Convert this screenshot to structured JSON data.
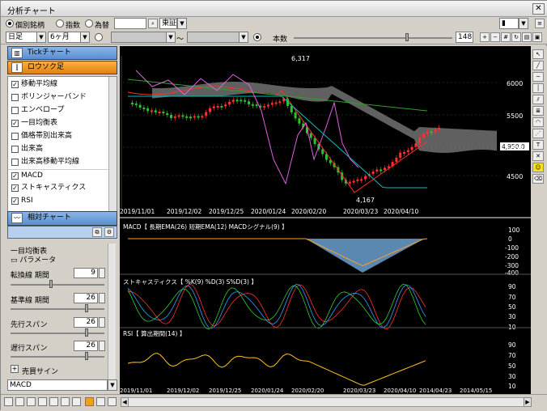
{
  "window": {
    "title": "分析チャート",
    "close": "✕"
  },
  "toolbar": {
    "radio_stock": "個別銘柄",
    "radio_index": "指数",
    "radio_fx": "為替",
    "exchange": "東証",
    "period_unit": "日足",
    "period_range": "6ヶ月",
    "count_label": "本数",
    "count_value": "148",
    "tilde": "〜"
  },
  "sidebar": {
    "tick_chart": "Tickチャート",
    "candle": "ロウソク足",
    "items": [
      {
        "label": "移動平均線",
        "checked": true
      },
      {
        "label": "ボリンジャーバンド",
        "checked": false
      },
      {
        "label": "エンベロープ",
        "checked": false
      },
      {
        "label": "一目均衡表",
        "checked": true
      },
      {
        "label": "価格帯別出来高",
        "checked": false
      },
      {
        "label": "出来高",
        "checked": false
      },
      {
        "label": "出来高移動平均線",
        "checked": false
      },
      {
        "label": "MACD",
        "checked": true
      },
      {
        "label": "ストキャスティクス",
        "checked": true
      },
      {
        "label": "RSI",
        "checked": true
      }
    ],
    "relative_chart": "相対チャート",
    "params_title": "一目均衡表",
    "params_sub": "パラメータ",
    "params": [
      {
        "label": "転換線 期間",
        "value": "9"
      },
      {
        "label": "基準線 期間",
        "value": "26"
      },
      {
        "label": "先行スパン",
        "value": "26"
      },
      {
        "label": "遅行スパン",
        "value": "26"
      }
    ],
    "signal": "売買サイン",
    "bottom_select": "MACD"
  },
  "price_panel": {
    "high_label": "6,317",
    "low_label": "4,167",
    "last_price": "4,950.0",
    "y_ticks": [
      "6000",
      "5500",
      "5000",
      "4500"
    ],
    "x_ticks": [
      "2019/11/01",
      "2019/12/02",
      "2019/12/25",
      "2020/01/24",
      "2020/02/20",
      "2020/03/23",
      "2020/04/10"
    ]
  },
  "macd_panel": {
    "header": "MACD【 長期EMA(26) 短期EMA(12) MACDシグナル(9) 】",
    "y_ticks": [
      "100",
      "0",
      "-100",
      "-200",
      "-300",
      "-400"
    ]
  },
  "stoch_panel": {
    "header": "ストキャスティクス【 %K(9) %D(3) S%D(3) 】",
    "y_ticks": [
      "90",
      "70",
      "50",
      "30",
      "10"
    ]
  },
  "rsi_panel": {
    "header": "RSI【 算出期間(14) 】",
    "y_ticks": [
      "90",
      "70",
      "50",
      "30",
      "10"
    ],
    "x_ticks": [
      "2019/11/01",
      "2019/12/02",
      "2019/12/25",
      "2020/01/24",
      "2020/02/20",
      "2020/03/23",
      "2020/04/10",
      "2014/04/23",
      "2014/05/15"
    ]
  },
  "colors": {
    "bg": "#000000",
    "cloud": "#808080",
    "up": "#ff3030",
    "down": "#30c030",
    "ma_short": "#ff3030",
    "ma_mid": "#30a030",
    "lag": "#e060e0",
    "macd_fill": "#6aa0d0",
    "signal": "#ffa020",
    "rsi": "#ffc020"
  }
}
